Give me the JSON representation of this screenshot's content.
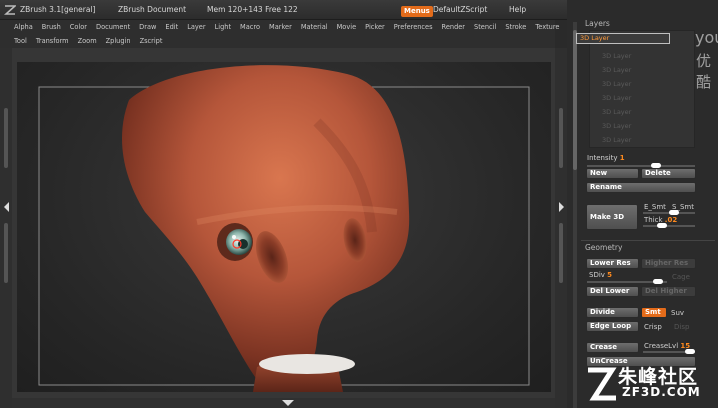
{
  "titlebar": {
    "app": "ZBrush 3.1[general]",
    "document": "ZBrush Document",
    "mem": "Mem 120+143  Free 122",
    "menus": "Menus",
    "script": "DefaultZScript",
    "help": "Help"
  },
  "menubar": {
    "row1": [
      "Alpha",
      "Brush",
      "Color",
      "Document",
      "Draw",
      "Edit",
      "Layer",
      "Light",
      "Macro",
      "Marker",
      "Material",
      "Movie",
      "Picker",
      "Preferences",
      "Render",
      "Stencil",
      "Stroke",
      "Texture"
    ],
    "row2": [
      "Tool",
      "Transform",
      "Zoom",
      "Zplugin",
      "Zscript"
    ]
  },
  "layers": {
    "title": "Layers",
    "active": "3D Layer",
    "inactive": [
      "3D Layer",
      "3D Layer",
      "3D Layer",
      "3D Layer",
      "3D Layer",
      "3D Layer",
      "3D Layer"
    ],
    "intensity_label": "Intensity",
    "intensity_value": "1",
    "new": "New",
    "delete": "Delete",
    "rename": "Rename",
    "make3d": "Make 3D",
    "e_smt": "E_Smt",
    "s_smt": "S_Smt",
    "thick_label": "Thick",
    "thick_value": ".02"
  },
  "geometry": {
    "title": "Geometry",
    "lower_res": "Lower Res",
    "higher_res": "Higher Res",
    "sdiv_label": "SDiv",
    "sdiv_value": "5",
    "cage": "Cage",
    "del_lower": "Del Lower",
    "del_higher": "Del Higher",
    "divide": "Divide",
    "smt": "Smt",
    "suv": "Suv",
    "edge_loop": "Edge Loop",
    "crisp": "Crisp",
    "disp": "Disp",
    "crease": "Crease",
    "crease_lvl_label": "CreaseLvl",
    "crease_lvl_value": "15",
    "uncrease": "UnCrease"
  },
  "watermark": {
    "you": "you",
    "you2": "优酷",
    "site_cn": "朱峰社区",
    "site_en": "ZF3D.COM"
  }
}
